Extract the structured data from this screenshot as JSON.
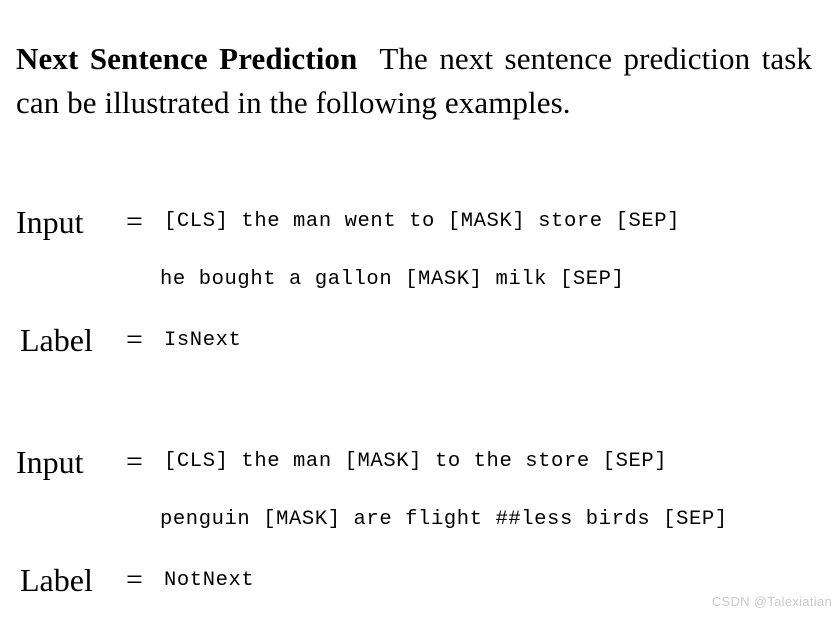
{
  "document": {
    "section_heading": "Next Sentence Prediction",
    "intro_text": "The next sentence prediction task can be illustrated in the following examples.",
    "input_label": "Input",
    "label_label": "Label",
    "equals_sign": "=",
    "examples": [
      {
        "input_line_1": "[CLS] the man went to [MASK] store [SEP]",
        "input_line_2": "he bought a gallon [MASK] milk [SEP]",
        "label_value": "IsNext"
      },
      {
        "input_line_1": "[CLS] the man [MASK] to the store [SEP]",
        "input_line_2": "penguin [MASK] are flight ##less birds [SEP]",
        "label_value": "NotNext"
      }
    ]
  },
  "watermark": {
    "text": "CSDN @Talexiatian",
    "color": "#c9c9c9"
  },
  "colors": {
    "background": "#ffffff",
    "text": "#000000"
  }
}
